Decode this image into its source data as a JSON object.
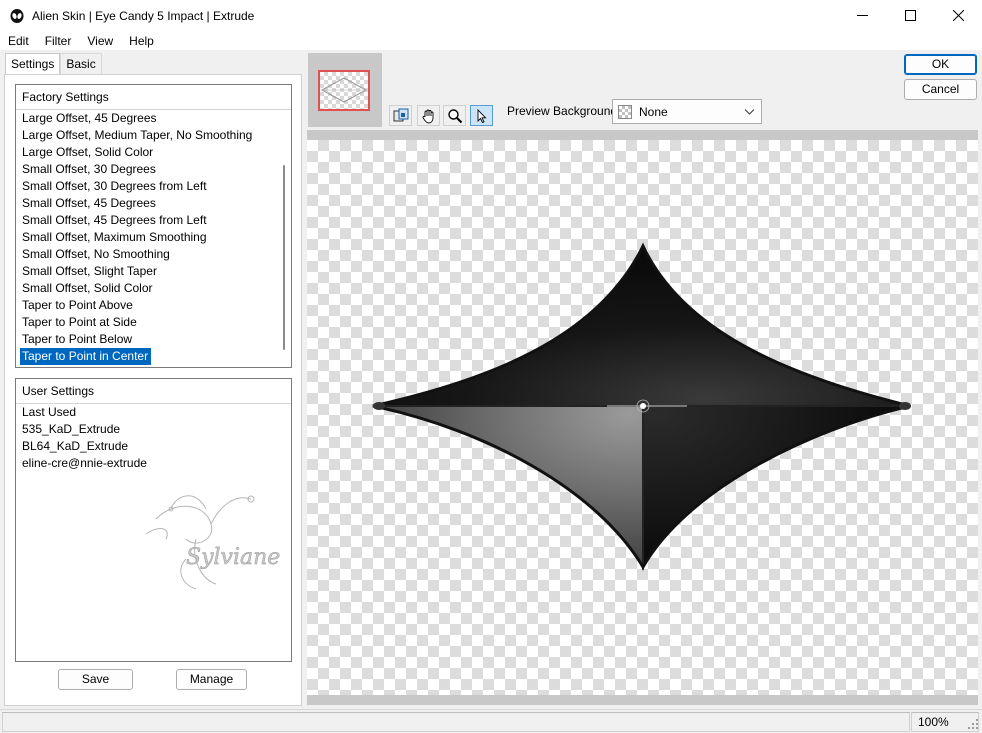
{
  "window": {
    "title": "Alien Skin | Eye Candy 5 Impact | Extrude",
    "controls": [
      "minimize-icon",
      "maximize-icon",
      "close-icon"
    ]
  },
  "menu": [
    "Edit",
    "Filter",
    "View",
    "Help"
  ],
  "tabs": [
    "Settings",
    "Basic"
  ],
  "factory_settings": {
    "header": "Factory Settings",
    "items": [
      "Large Offset, 45 Degrees",
      "Large Offset, Medium Taper, No Smoothing",
      "Large Offset, Solid Color",
      "Small Offset, 30 Degrees",
      "Small Offset, 30 Degrees from Left",
      "Small Offset, 45 Degrees",
      "Small Offset, 45 Degrees from Left",
      "Small Offset, Maximum Smoothing",
      "Small Offset, No Smoothing",
      "Small Offset, Slight Taper",
      "Small Offset, Solid Color",
      "Taper to Point Above",
      "Taper to Point at Side",
      "Taper to Point Below",
      "Taper to Point in Center"
    ],
    "selected": "Taper to Point in Center"
  },
  "user_settings": {
    "header": "User Settings",
    "items": [
      "Last Used",
      "535_KaD_Extrude",
      "BL64_KaD_Extrude",
      "eline-cre@nnie-extrude"
    ],
    "watermark": "Sylviane"
  },
  "buttons": {
    "save": "Save",
    "manage": "Manage",
    "ok": "OK",
    "cancel": "Cancel"
  },
  "toolbar": {
    "tools": [
      "preview-toggle-icon",
      "hand-icon",
      "zoom-icon",
      "pointer-icon"
    ],
    "active_tool": "pointer-icon",
    "preview_background_label": "Preview Background:",
    "preview_background_value": "None"
  },
  "status": {
    "zoom": "100%"
  }
}
